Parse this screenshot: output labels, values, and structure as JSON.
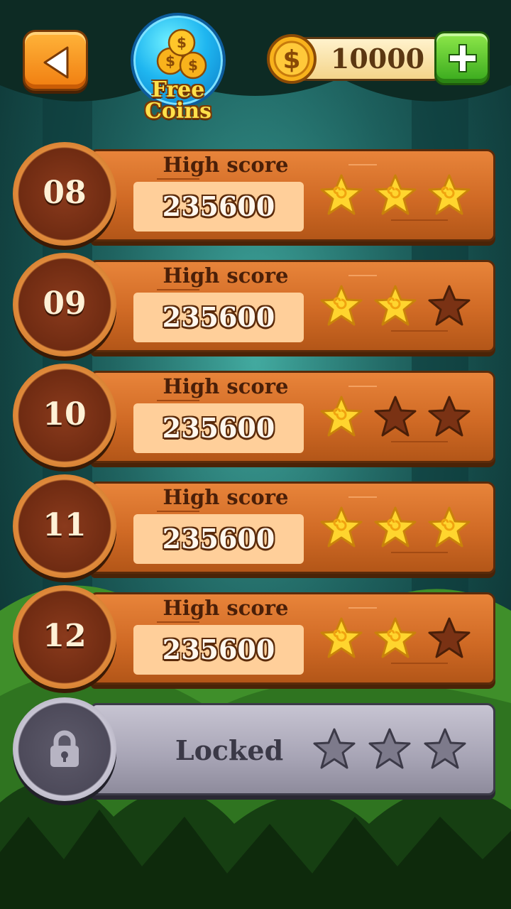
{
  "header": {
    "free_coins_label_line1": "Free",
    "free_coins_label_line2": "Coins",
    "coin_balance": "10000"
  },
  "levels": [
    {
      "number": "08",
      "label": "High score",
      "score": "235600",
      "stars": 3
    },
    {
      "number": "09",
      "label": "High score",
      "score": "235600",
      "stars": 2
    },
    {
      "number": "10",
      "label": "High score",
      "score": "235600",
      "stars": 1
    },
    {
      "number": "11",
      "label": "High score",
      "score": "235600",
      "stars": 3
    },
    {
      "number": "12",
      "label": "High score",
      "score": "235600",
      "stars": 2
    }
  ],
  "locked_level": {
    "label": "Locked",
    "stars": 0
  },
  "colors": {
    "star_filled": "#ffd52e",
    "star_empty": "#7a3214",
    "star_locked": "#7d7a8b"
  }
}
